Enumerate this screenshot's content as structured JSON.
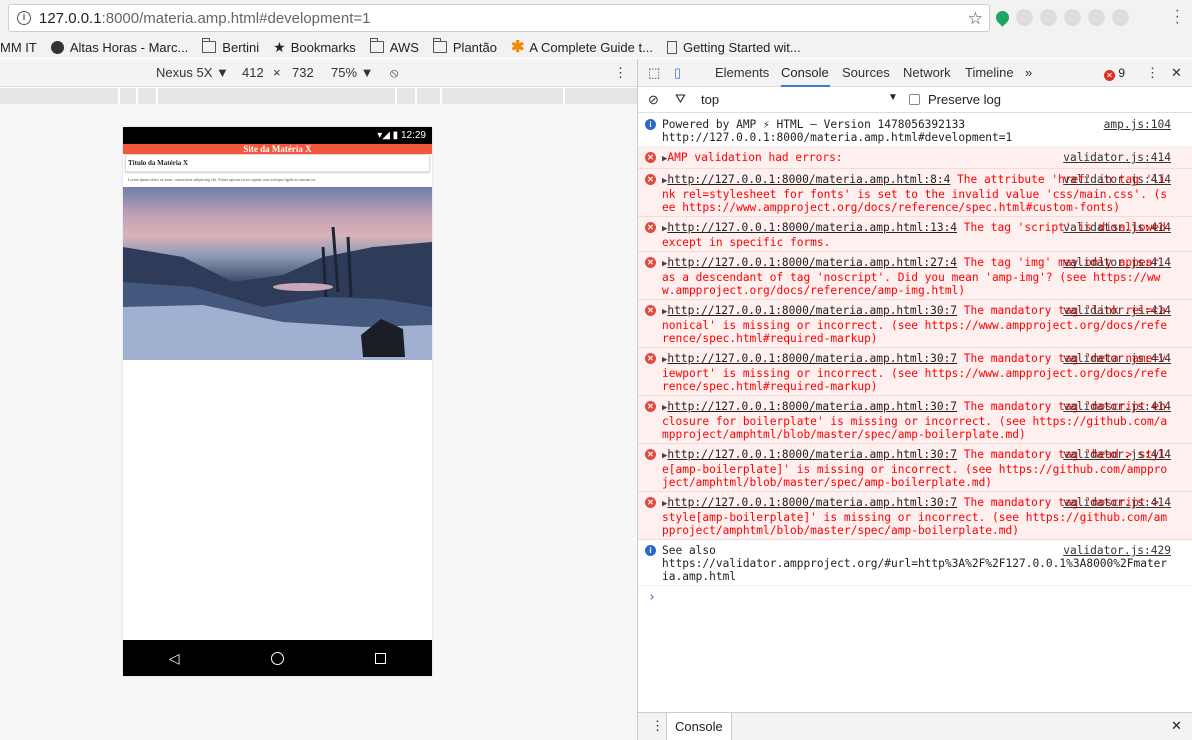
{
  "browser": {
    "url_host": "127.0.0.1",
    "url_rest": ":8000/materia.amp.html#development=1",
    "bookmarks": [
      "MM IT",
      "Altas Horas - Marc...",
      "Bertini",
      "Bookmarks",
      "AWS",
      "Plantão",
      "A Complete Guide t...",
      "Getting Started wit..."
    ]
  },
  "device_toolbar": {
    "device": "Nexus 5X",
    "width": "412",
    "times": "×",
    "height": "732",
    "zoom": "75%"
  },
  "phone": {
    "time": "12:29",
    "site_header": "Site da Matéria X",
    "article_title": "Título da Matéria X",
    "lorem": "Lorem ipsum dolor sit amet, consectetur adipiscing elit. Etiam egestas tortor sapien, non tristique ligula accumsan eu."
  },
  "devtools": {
    "tabs": [
      "Elements",
      "Console",
      "Sources",
      "Network",
      "Timeline"
    ],
    "more": "»",
    "error_count": "9",
    "filter_context": "top",
    "preserve_log": "Preserve log",
    "messages": [
      {
        "type": "info",
        "text": "Powered by AMP ⚡ HTML – Version 1478056392133\nhttp://127.0.0.1:8000/materia.amp.html#development=1",
        "src": "amp.js:104"
      },
      {
        "type": "error",
        "text": "AMP validation had errors:",
        "src": "validator.js:414"
      },
      {
        "type": "error",
        "link": "http://127.0.0.1:8000/materia.amp.html:8:4",
        "text": " The attribute 'href' in tag 'link rel=stylesheet for fonts' is set to the invalid value 'css/main.css'. (see https://www.ampproject.org/docs/reference/spec.html#custom-fonts)",
        "src": "validator.js:414"
      },
      {
        "type": "error",
        "link": "http://127.0.0.1:8000/materia.amp.html:13:4",
        "text": " The tag 'script' is disallowed except in specific forms.",
        "src": "validator.js:414"
      },
      {
        "type": "error",
        "link": "http://127.0.0.1:8000/materia.amp.html:27:4",
        "text": " The tag 'img' may only appear as a descendant of tag 'noscript'. Did you mean 'amp-img'? (see https://www.ampproject.org/docs/reference/amp-img.html)",
        "src": "validator.js:414"
      },
      {
        "type": "error",
        "link": "http://127.0.0.1:8000/materia.amp.html:30:7",
        "text": " The mandatory tag 'link rel=canonical' is missing or incorrect. (see https://www.ampproject.org/docs/reference/spec.html#required-markup)",
        "src": "validator.js:414"
      },
      {
        "type": "error",
        "link": "http://127.0.0.1:8000/materia.amp.html:30:7",
        "text": " The mandatory tag 'meta name=viewport' is missing or incorrect. (see https://www.ampproject.org/docs/reference/spec.html#required-markup)",
        "src": "validator.js:414"
      },
      {
        "type": "error",
        "link": "http://127.0.0.1:8000/materia.amp.html:30:7",
        "text": " The mandatory tag 'noscript enclosure for boilerplate' is missing or incorrect. (see https://github.com/ampproject/amphtml/blob/master/spec/amp-boilerplate.md)",
        "src": "validator.js:414"
      },
      {
        "type": "error",
        "link": "http://127.0.0.1:8000/materia.amp.html:30:7",
        "text": " The mandatory tag 'head > style[amp-boilerplate]' is missing or incorrect. (see https://github.com/ampproject/amphtml/blob/master/spec/amp-boilerplate.md)",
        "src": "validator.js:414"
      },
      {
        "type": "error",
        "link": "http://127.0.0.1:8000/materia.amp.html:30:7",
        "text": " The mandatory tag 'noscript > style[amp-boilerplate]' is missing or incorrect. (see https://github.com/ampproject/amphtml/blob/master/spec/amp-boilerplate.md)",
        "src": "validator.js:414"
      },
      {
        "type": "info",
        "text": "See also\nhttps://validator.ampproject.org/#url=http%3A%2F%2F127.0.0.1%3A8000%2Fmateria.amp.html",
        "src": "validator.js:429"
      }
    ],
    "prompt": "›",
    "drawer_tab": "Console"
  },
  "colors": {
    "site_header": "#f4573e",
    "error_text": "#ff0000",
    "error_bg": "#fff0f0",
    "accent": "#3879d9"
  }
}
